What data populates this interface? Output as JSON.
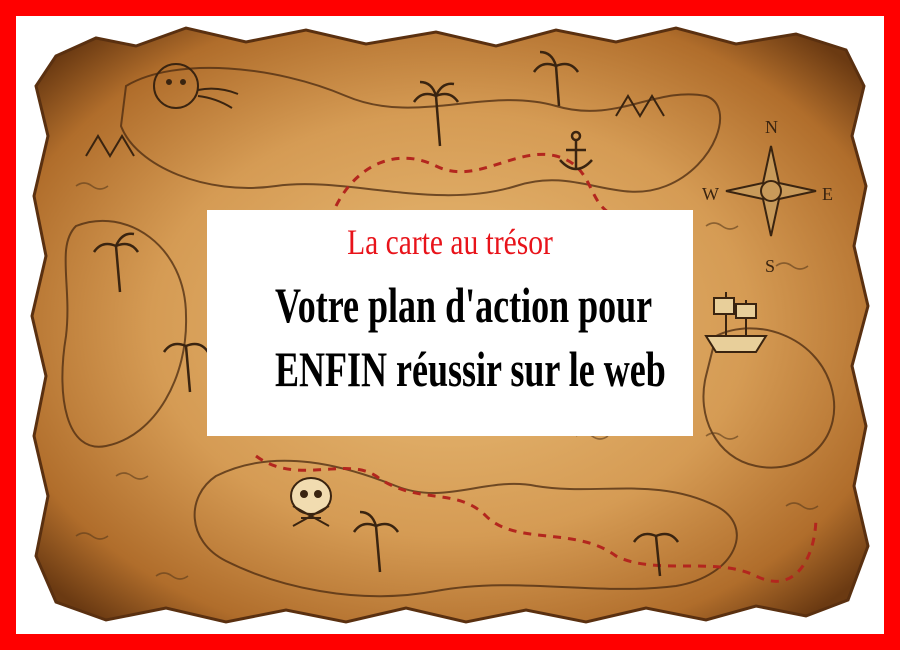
{
  "banner": {
    "subtitle": "La carte au trésor",
    "headline_line1": "Votre plan d'action pour",
    "headline_line2": "ENFIN réussir sur le web"
  },
  "map": {
    "compass_letters": [
      "N",
      "W",
      "E",
      "S"
    ]
  },
  "colors": {
    "frame": "#ff0000",
    "parchment": "#d9a15a",
    "subtitle": "#e8131a",
    "trail": "#b3261e"
  }
}
